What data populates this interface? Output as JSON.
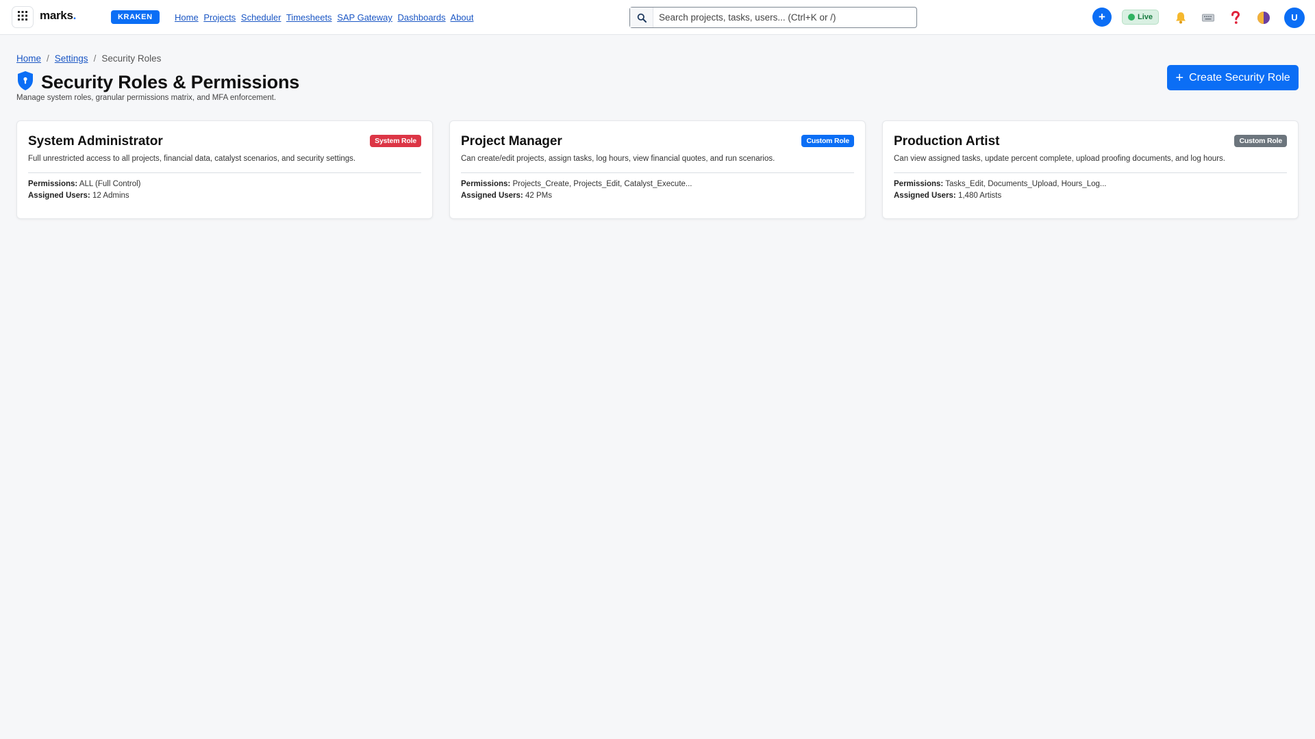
{
  "colors": {
    "accent": "#0b6ef5",
    "system_role_badge": "#dc3545",
    "custom_role_badge": "#0b6ef5",
    "secondary_badge": "#6c757d",
    "live": "#2fb360"
  },
  "topbar": {
    "apps_icon": "grid-icon",
    "logo_text": "marks",
    "logo_dot": ".",
    "env_badge": "KRAKEN",
    "nav": [
      "Home",
      "Projects",
      "Scheduler",
      "Timesheets",
      "SAP Gateway",
      "Dashboards",
      "About"
    ],
    "search_placeholder": "Search projects, tasks, users... (Ctrl+K or /)",
    "quick_add_label": "+",
    "live_label": "Live",
    "icons": [
      "bell-icon",
      "keyboard-icon",
      "help-icon",
      "theme-toggle-icon"
    ],
    "avatar_initial": "U"
  },
  "breadcrumb": {
    "home": "Home",
    "settings": "Settings",
    "separator": "/",
    "current": "Security Roles"
  },
  "header": {
    "title": "Security Roles & Permissions",
    "subtitle": "Manage system roles, granular permissions matrix, and MFA enforcement.",
    "create_button": "Create Security Role",
    "create_icon": "+"
  },
  "roles": [
    {
      "name": "System Administrator",
      "badge": "System Role",
      "description": "Full unrestricted access to all projects, financial data, catalyst scenarios, and security settings.",
      "permissions_label": "Permissions:",
      "permissions": "ALL (Full Control)",
      "users_label": "Assigned Users:",
      "users": "12 Admins"
    },
    {
      "name": "Project Manager",
      "badge": "Custom Role",
      "description": "Can create/edit projects, assign tasks, log hours, view financial quotes, and run scenarios.",
      "permissions_label": "Permissions:",
      "permissions": "Projects_Create, Projects_Edit, Catalyst_Execute...",
      "users_label": "Assigned Users:",
      "users": "42 PMs"
    },
    {
      "name": "Production Artist",
      "badge": "Custom Role",
      "description": "Can view assigned tasks, update percent complete, upload proofing documents, and log hours.",
      "permissions_label": "Permissions:",
      "permissions": "Tasks_Edit, Documents_Upload, Hours_Log...",
      "users_label": "Assigned Users:",
      "users": "1,480 Artists"
    }
  ]
}
